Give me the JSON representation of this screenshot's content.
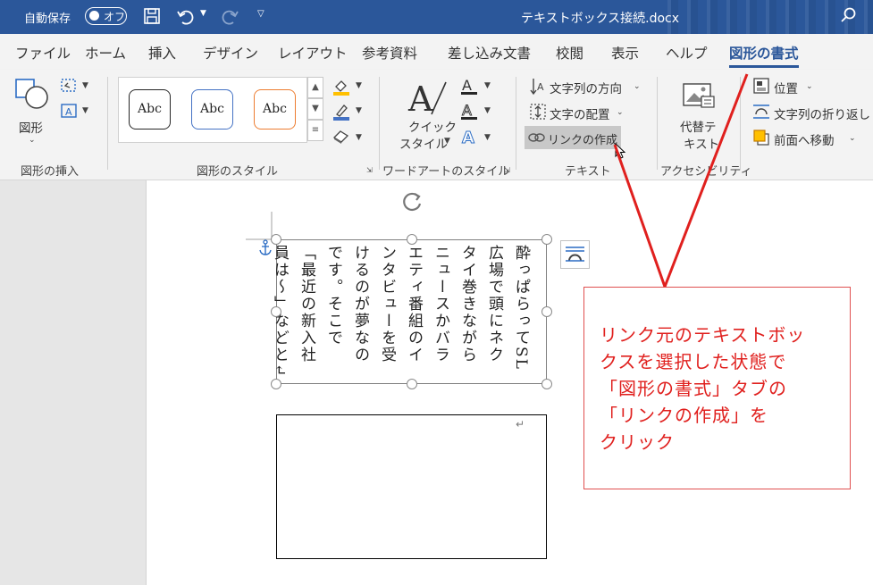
{
  "titlebar": {
    "autosave_label": "自動保存",
    "autosave_state": "オフ",
    "document_title": "テキストボックス接続.docx"
  },
  "tabs": [
    {
      "label": "ファイル"
    },
    {
      "label": "ホーム"
    },
    {
      "label": "挿入"
    },
    {
      "label": "デザイン"
    },
    {
      "label": "レイアウト"
    },
    {
      "label": "参考資料"
    },
    {
      "label": "差し込み文書"
    },
    {
      "label": "校閲"
    },
    {
      "label": "表示"
    },
    {
      "label": "ヘルプ"
    },
    {
      "label": "図形の書式",
      "active": true
    }
  ],
  "ribbon": {
    "insert_shapes": {
      "shapes_label": "図形",
      "group_label": "図形の挿入"
    },
    "shape_styles": {
      "samples": [
        "Abc",
        "Abc",
        "Abc"
      ],
      "sample_border_colors": [
        "#262626",
        "#4472c4",
        "#ed7d31"
      ],
      "group_label": "図形のスタイル"
    },
    "wordart": {
      "quick_style_line1": "クイック",
      "quick_style_line2": "スタイル",
      "group_label": "ワードアートのスタイル"
    },
    "text": {
      "text_direction": "文字列の方向",
      "align_text": "文字の配置",
      "create_link": "リンクの作成",
      "group_label": "テキスト"
    },
    "accessibility": {
      "alt_text_line1": "代替テ",
      "alt_text_line2": "キスト",
      "group_label": "アクセシビリティ"
    },
    "arrange": {
      "position": "位置",
      "wrap_text": "文字列の折り返し",
      "bring_forward": "前面へ移動"
    }
  },
  "document": {
    "textbox1_text": "酔っぱらってSL広場で頭にネクタイ巻きながらニュースかバラエティ番組のインタビューを受けるのが夢なのです。そこで「最近の新入社員は～」などと↵",
    "textbox2_mark": "↵"
  },
  "callout": {
    "text": "リンク元のテキストボッ\nクスを選択した状態で\n「図形の書式」タブの\n「リンクの作成」を\nクリック",
    "color": "#e0201e"
  },
  "colors": {
    "accent": "#2b579a",
    "annotation_red": "#e0201e"
  }
}
